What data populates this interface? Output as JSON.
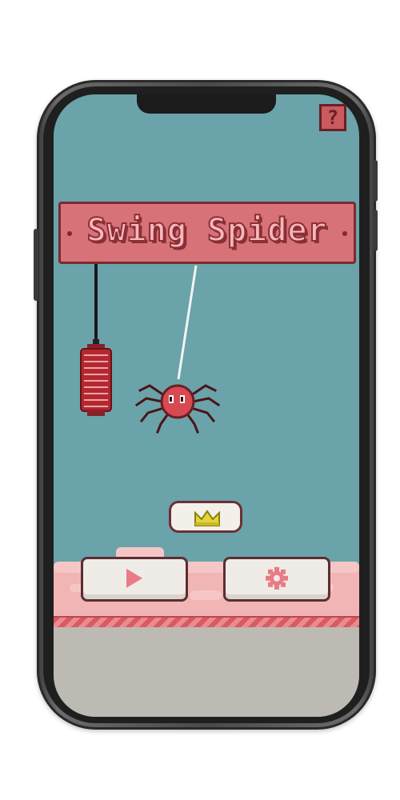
{
  "game": {
    "title": "Swing Spider",
    "help_label": "?"
  },
  "buttons": {
    "play_icon": "play-icon",
    "settings_icon": "gear-icon"
  },
  "score_pill": {
    "icon": "crown-icon"
  },
  "colors": {
    "sky": "#6aa3aa",
    "plank": "#d67278",
    "plank_border": "#7a2b31",
    "title_fill": "#f7b7ba",
    "spider": "#d84a52",
    "ground_pink": "#f1b5b5",
    "ground_grey": "#bdb9b3",
    "button_face": "#efece7",
    "accent_pink": "#e97b86",
    "crown": "#e3d63a"
  }
}
